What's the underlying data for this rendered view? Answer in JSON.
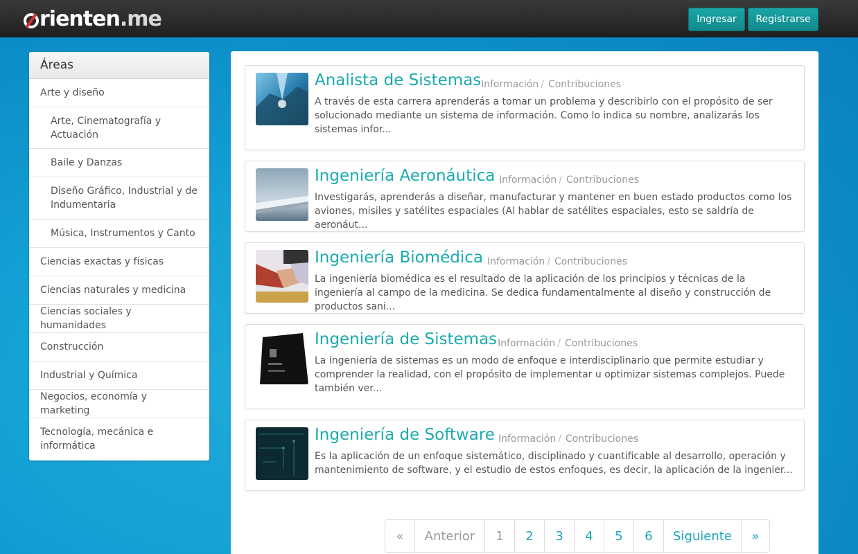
{
  "header": {
    "logo_main": "orienten",
    "logo_suffix": ".me",
    "login_label": "Ingresar",
    "register_label": "Registrarse"
  },
  "sidebar": {
    "title": "Áreas",
    "items": [
      {
        "label": "Arte y diseño",
        "level": 0
      },
      {
        "label": "Arte, Cinematografía y Actuación",
        "level": 1
      },
      {
        "label": "Baile y Danzas",
        "level": 1
      },
      {
        "label": "Diseño Gráfico, Industrial y de Indumentaria",
        "level": 1
      },
      {
        "label": "Música, Instrumentos y Canto",
        "level": 1
      },
      {
        "label": "Ciencias exactas y físicas",
        "level": 0
      },
      {
        "label": "Ciencias naturales y medicina",
        "level": 0
      },
      {
        "label": "Ciencias sociales y humanidades",
        "level": 0
      },
      {
        "label": "Construcción",
        "level": 0
      },
      {
        "label": "Industrial y Química",
        "level": 0
      },
      {
        "label": "Negocios, economía y marketing",
        "level": 0
      },
      {
        "label": "Tecnología, mecánica e informática",
        "level": 0
      }
    ]
  },
  "careers": [
    {
      "title": "Analista de Sistemas",
      "info_label": "Información",
      "contrib_label": "Contribuciones",
      "description": "A través de esta carrera aprenderás a tomar un problema y describirlo con el propósito de ser solucionado mediante un sistema de información. Como lo indica su nombre, analizarás los sistemas infor..."
    },
    {
      "title": "Ingeniería Aeronáutica",
      "info_label": "Información",
      "contrib_label": "Contribuciones",
      "description": "Investigarás, aprenderás a diseñar, manufacturar y mantener en buen estado productos como los aviones, misiles y satélites espaciales (Al hablar de satélites espaciales, esto se saldría de aeronáut..."
    },
    {
      "title": "Ingeniería Biomédica",
      "info_label": "Información",
      "contrib_label": "Contribuciones",
      "description": "La ingeniería biomédica es el resultado de la aplicación de los principios y técnicas de la ingeniería al campo de la medicina. Se dedica fundamentalmente al diseño y construcción de productos sani..."
    },
    {
      "title": "Ingeniería de Sistemas",
      "info_label": "Información",
      "contrib_label": "Contribuciones",
      "description": "La ingeniería de sistemas es un modo de enfoque e interdisciplinario que permite estudiar y comprender la realidad, con el propósito de implementar u optimizar sistemas complejos. Puede también ver..."
    },
    {
      "title": "Ingeniería de Software",
      "info_label": "Información",
      "contrib_label": "Contribuciones",
      "description": "Es la aplicación de un enfoque sistemático, disciplinado y cuantificable al desarrollo, operación y mantenimiento de software, y el estudio de estos enfoques, es decir, la aplicación de la ingenier..."
    }
  ],
  "thumb_icons": [
    "city-aerial-thumbnail",
    "airplane-wing-thumbnail",
    "handshake-thumbnail",
    "phone-screen-thumbnail",
    "circuit-board-thumbnail"
  ],
  "pagination": {
    "first": "«",
    "prev": "Anterior",
    "pages": [
      "1",
      "2",
      "3",
      "4",
      "5",
      "6"
    ],
    "next": "Siguiente",
    "last": "»"
  },
  "colors": {
    "accent": "#1aabb0",
    "topbar": "#2a2a2a",
    "background": "#13a0d4"
  }
}
